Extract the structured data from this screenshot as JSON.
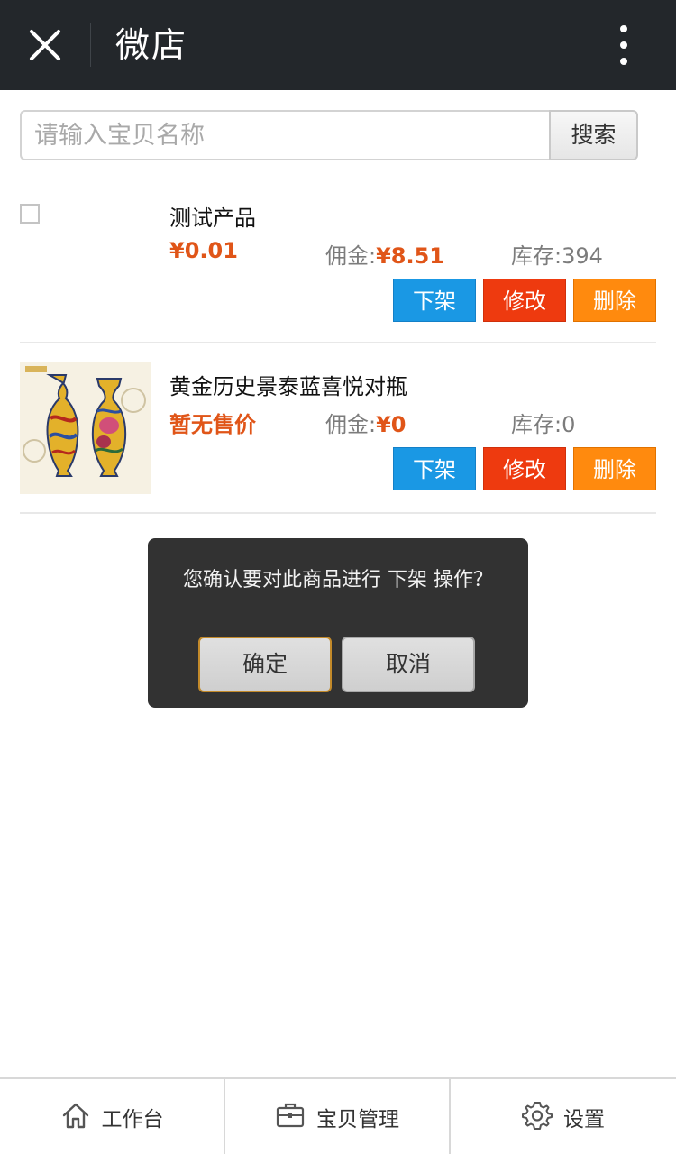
{
  "header": {
    "title": "微店",
    "close_icon": "close-icon",
    "more_icon": "more-vertical-icon"
  },
  "search": {
    "placeholder": "请输入宝贝名称",
    "value": "",
    "button_label": "搜索"
  },
  "products": [
    {
      "name": "测试产品",
      "price": "¥0.01",
      "commission_label": "佣金:",
      "commission_value": "¥8.51",
      "stock": "库存:394",
      "has_checkbox": true,
      "actions": {
        "off_shelf": "下架",
        "edit": "修改",
        "delete": "删除"
      }
    },
    {
      "name": "黄金历史景泰蓝喜悦对瓶",
      "price": "暂无售价",
      "commission_label": "佣金:",
      "commission_value": "¥0",
      "stock": "库存:0",
      "image": "vase-pair-image",
      "actions": {
        "off_shelf": "下架",
        "edit": "修改",
        "delete": "删除"
      }
    }
  ],
  "dialog": {
    "message": "您确认要对此商品进行 下架 操作？",
    "confirm_label": "确定",
    "cancel_label": "取消"
  },
  "bottom_nav": [
    {
      "label": "工作台",
      "icon": "home-icon"
    },
    {
      "label": "宝贝管理",
      "icon": "briefcase-icon"
    },
    {
      "label": "设置",
      "icon": "gear-icon"
    }
  ],
  "colors": {
    "header_bg": "#23272b",
    "price": "#e05518",
    "off_shelf_button": "#1a98e4",
    "edit_button": "#ee3a0f",
    "delete_button": "#ff8a0e",
    "dialog_bg": "#323232"
  }
}
